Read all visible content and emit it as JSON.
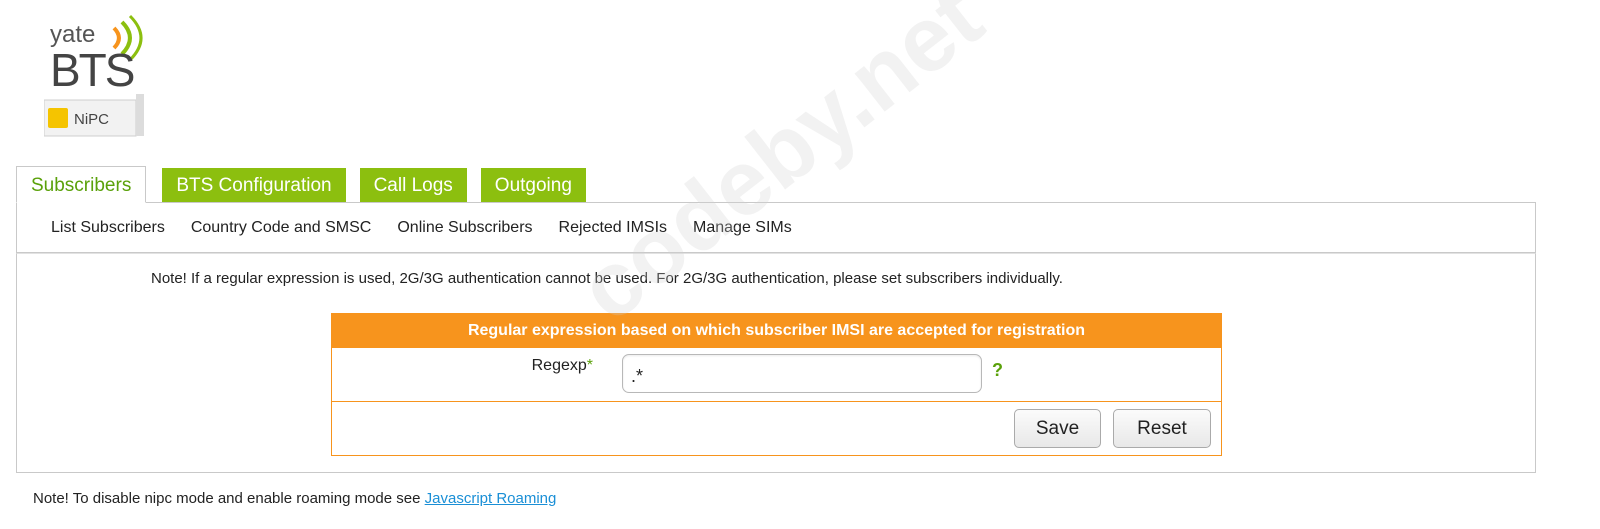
{
  "logo": {
    "top_text": "yate",
    "main_text": "BTS",
    "badge_text": "NiPC"
  },
  "tabs": [
    {
      "label": "Subscribers",
      "active": true
    },
    {
      "label": "BTS Configuration",
      "active": false
    },
    {
      "label": "Call Logs",
      "active": false
    },
    {
      "label": "Outgoing",
      "active": false
    }
  ],
  "subnav": [
    {
      "label": "List Subscribers"
    },
    {
      "label": "Country Code and SMSC"
    },
    {
      "label": "Online Subscribers"
    },
    {
      "label": "Rejected IMSIs"
    },
    {
      "label": "Manage SIMs"
    }
  ],
  "content": {
    "note_top": "Note! If a regular expression is used, 2G/3G authentication cannot be used. For 2G/3G authentication, please set subscribers individually.",
    "form": {
      "header": "Regular expression based on which subscriber IMSI are accepted for registration",
      "regexp_label": "Regexp",
      "required_mark": "*",
      "regexp_value": ".*",
      "help_label": "?",
      "save_label": "Save",
      "reset_label": "Reset"
    }
  },
  "footer": {
    "note_prefix": "Note! To disable nipc mode and enable roaming mode see ",
    "link_label": "Javascript Roaming"
  },
  "watermark": "codeby.net",
  "colors": {
    "tab_green": "#8cbf0f",
    "active_text_green": "#5aa10a",
    "form_orange": "#f7941d",
    "link_blue": "#1a8fd6"
  }
}
